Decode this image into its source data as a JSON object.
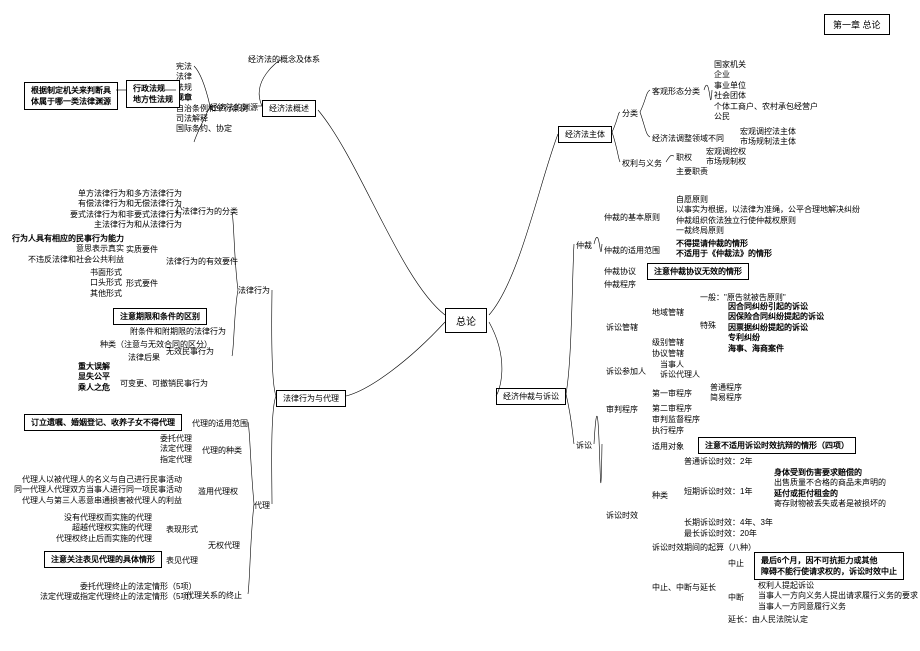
{
  "title": "第一章  总论",
  "root": "总论",
  "section1": {
    "title": "经济法概述",
    "sub1": "经济法的概念及体系",
    "sub2": "经济法的渊源",
    "sources": [
      "宪法",
      "法律",
      "法规",
      "规章",
      "自治条例和单行条例",
      "司法解释",
      "国际条约、协定"
    ],
    "badge1a": "行政法规",
    "badge1b": "地方性法规",
    "note1_line1": "根据制定机关来判断具",
    "note1_line2": "体属于哪一类法律渊源"
  },
  "section2": {
    "title": "经济法主体",
    "sub1": "分类",
    "sub1a": "客观形态分类",
    "sub1a_items": [
      "国家机关",
      "企业",
      "事业单位",
      "社会团体",
      "个体工商户、农村承包经营户",
      "公民"
    ],
    "sub1b": "经济法调整领域不同",
    "sub1b_items": [
      "宏观调控法主体",
      "市场规制法主体"
    ],
    "sub2": "权利与义务",
    "sub2a": "职权",
    "sub2a_items": [
      "宏观调控权",
      "市场规制权"
    ],
    "sub2b": "主要职责"
  },
  "section3": {
    "title": "法律行为与代理",
    "sub1": "法律行为",
    "s3_1_1": "法律行为的分类",
    "s3_1_1_items": [
      "单方法律行为和多方法律行为",
      "有偿法律行为和无偿法律行为",
      "要式法律行为和非要式法律行为",
      "主法律行为和从法律行为"
    ],
    "s3_1_2": "法律行为的有效要件",
    "s3_1_2a": "实质要件",
    "s3_1_2a_items": [
      "行为人具有相应的民事行为能力",
      "意思表示真实",
      "不违反法律和社会公共利益"
    ],
    "s3_1_2b": "形式要件",
    "s3_1_2b_items": [
      "书面形式",
      "口头形式",
      "其他形式"
    ],
    "s3_1_3": "附条件和附期限的法律行为",
    "s3_1_3a_box": "注意期限和条件的区别",
    "s3_1_3b": "种类（注意与无效合同的区分）",
    "s3_1_3c": "法律后果",
    "s3_1_3c1": "无效民事行为",
    "s3_1_3c2": "可变更、可撤销民事行为",
    "s3_1_3c2_items": [
      "重大误解",
      "显失公平",
      "乘人之危"
    ],
    "sub2": "代理",
    "s3_2_1": "代理的适用范围",
    "s3_2_1_box": "订立遗嘱、婚姻登记、收养子女不得代理",
    "s3_2_2": "代理的种类",
    "s3_2_2_items": [
      "委托代理",
      "法定代理",
      "指定代理"
    ],
    "s3_2_3": "滥用代理权",
    "s3_2_3_items": [
      "代理人以被代理人的名义与自己进行民事活动",
      "同一代理人代理双方当事人进行同一项民事活动",
      "代理人与第三人恶意串通损害被代理人的利益"
    ],
    "s3_2_4": "无权代理",
    "s3_2_4a": "表现形式",
    "s3_2_4a_items": [
      "没有代理权而实施的代理",
      "超越代理权实施的代理",
      "代理权终止后而实施的代理"
    ],
    "s3_2_4b": "表见代理",
    "s3_2_4b_box": "注意关注表见代理的具体情形",
    "s3_2_5": "代理关系的终止",
    "s3_2_5_items": [
      "委托代理终止的法定情形（5项）",
      "法定代理或指定代理终止的法定情形（5项）"
    ]
  },
  "section4": {
    "title": "经济仲裁与诉讼",
    "sub1": "仲裁",
    "s4_1_1": "仲裁的基本原则",
    "s4_1_1_items": [
      "自愿原则",
      "以事实为根据，以法律为准绳，公平合理地解决纠纷",
      "仲裁组织依法独立行使仲裁权原则",
      "一裁终局原则"
    ],
    "s4_1_2": "仲裁的适用范围",
    "s4_1_2_items": [
      "不得提请仲裁的情形",
      "不适用于《仲裁法》的情形"
    ],
    "s4_1_3": "仲裁协议",
    "s4_1_3_box": "注意仲裁协议无效的情形",
    "s4_1_4": "仲裁程序",
    "sub2": "诉讼",
    "s4_2_1": "诉讼管辖",
    "s4_2_1a": "地域管辖",
    "s4_2_1a1": "一般：\"原告就被告原则\"",
    "s4_2_1a2": "特殊",
    "s4_2_1a2_items": [
      "因合同纠纷引起的诉讼",
      "因保险合同纠纷提起的诉讼",
      "因票据纠纷提起的诉讼",
      "专利纠纷",
      "海事、海商案件"
    ],
    "s4_2_1b": "级别管辖",
    "s4_2_1c": "协议管辖",
    "s4_2_2": "诉讼参加人",
    "s4_2_2_items": [
      "当事人",
      "诉讼代理人"
    ],
    "s4_2_3": "审判程序",
    "s4_2_3a": "第一审程序",
    "s4_2_3a_items": [
      "普通程序",
      "简易程序"
    ],
    "s4_2_3b": "第二审程序",
    "s4_2_3c": "审判监督程序",
    "s4_2_3d": "执行程序",
    "s4_2_4": "诉讼时效",
    "s4_2_4a": "适用对象",
    "s4_2_4a_box": "注意不适用诉讼时效抗辩的情形（四项）",
    "s4_2_4b": "种类",
    "s4_2_4b1": "普通诉讼时效：2年",
    "s4_2_4b2": "短期诉讼时效：1年",
    "s4_2_4b2_items": [
      "身体受到伤害要求赔偿的",
      "出售质量不合格的商品未声明的",
      "延付或拒付租金的",
      "寄存财物被丢失或者是被损坏的"
    ],
    "s4_2_4b3": "长期诉讼时效：4年、3年",
    "s4_2_4b4": "最长诉讼时效：20年",
    "s4_2_4c": "诉讼时效期间的起算（八种）",
    "s4_2_4d": "中止、中断与延长",
    "s4_2_4d1": "中止",
    "s4_2_4d1_box_line1": "最后6个月，因不可抗拒力或其他",
    "s4_2_4d1_box_line2": "障碍不能行使请求权的，诉讼时效中止",
    "s4_2_4d2": "中断",
    "s4_2_4d2_items": [
      "权利人提起诉讼",
      "当事人一方向义务人提出请求履行义务的要求",
      "当事人一方同意履行义务"
    ],
    "s4_2_4d3": "延长：由人民法院认定"
  }
}
